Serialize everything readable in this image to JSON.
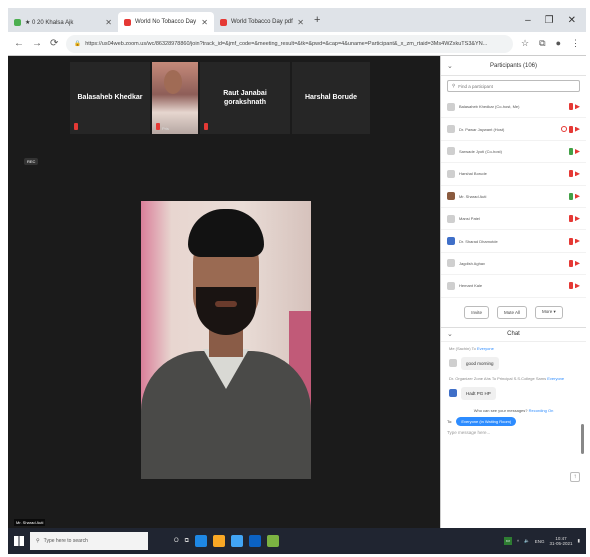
{
  "browser": {
    "tabs": [
      {
        "label": "★ 0 20 Khalsa Ajk",
        "active": false,
        "color": "#4caf50"
      },
      {
        "label": "World No Tobacco Day",
        "active": true,
        "color": "#e53935"
      },
      {
        "label": "World Tobacco Day pdf",
        "active": false,
        "color": "#e53935"
      }
    ],
    "url": "https://us04web.zoom.us/wc/86328978860/join?track_id=&jmf_code=&meeting_result=&tk=&pwd=&cap=4&uname=Participant&_x_zm_rtaid=3Ms4WZxkuTS3&YN...",
    "window_controls": [
      "–",
      "❐",
      "✕"
    ]
  },
  "gallery": {
    "tiles": [
      {
        "name": "Balasaheb Khedkar",
        "type": "text"
      },
      {
        "name": "",
        "caption": "Pris",
        "type": "photo"
      },
      {
        "name": "Raut Janabai gorakshnath",
        "type": "text"
      },
      {
        "name": "Harshal Borude",
        "type": "text"
      }
    ],
    "next_arrow": "›"
  },
  "rec_label": "REC",
  "speaker": {
    "name": "Mr. Sharad Auti"
  },
  "participants": {
    "title": "Participants (106)",
    "search_placeholder": "Find a participant",
    "items": [
      {
        "name": "Balasaheb Khedkar (Co-host, Me)",
        "avatar": "default",
        "mic": "off",
        "share": false
      },
      {
        "name": "Dr. Pawar Jaywant (Host)",
        "avatar": "default",
        "mic": "off",
        "share": true
      },
      {
        "name": "Sarwade Jyoti (Co-host)",
        "avatar": "default",
        "mic": "on",
        "share": false
      },
      {
        "name": "Harshal Borude",
        "avatar": "default",
        "mic": "off",
        "share": false
      },
      {
        "name": "Mr. Sharad Auti",
        "avatar": "img",
        "mic": "on",
        "share": false
      },
      {
        "name": "Mansi Patel",
        "avatar": "default",
        "mic": "off",
        "share": false
      },
      {
        "name": "Dr. Sharad Dhamotde",
        "avatar": "blue",
        "mic": "off",
        "share": false
      },
      {
        "name": "Jagdish Aghav",
        "avatar": "default",
        "mic": "off",
        "share": false
      },
      {
        "name": "Hemant Kale",
        "avatar": "default",
        "mic": "off",
        "share": false
      }
    ],
    "buttons": {
      "invite": "Invite",
      "mute_all": "Mute All",
      "more": "More ▾"
    }
  },
  "chat": {
    "title": "Chat",
    "messages": [
      {
        "from": "Me (Sachin) To",
        "to": "Everyone",
        "text": "good morning"
      },
      {
        "from": "Dr. Organizer Zone Ahs To Principal S.S.College Sams",
        "to": "Everyone",
        "text": "Hadt PG HP"
      }
    ],
    "notice_prefix": "Who can see your messages?",
    "notice_link": "Recording On",
    "to_label": "To:",
    "to_value": "Everyone (in Waiting Room)",
    "input_placeholder": "Type message here..."
  },
  "taskbar": {
    "search_placeholder": "Type here to search",
    "tray_lang": "ENG",
    "time": "10:47",
    "date": "31-05-2021"
  }
}
